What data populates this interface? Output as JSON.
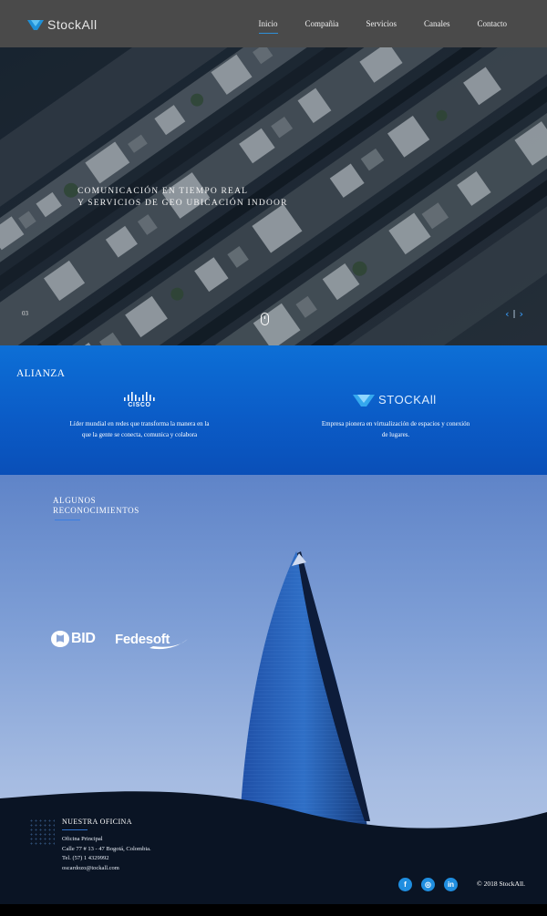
{
  "header": {
    "brand": "StockAll",
    "nav": [
      "Inicio",
      "Compañia",
      "Servicios",
      "Canales",
      "Contacto"
    ],
    "active_nav": "Inicio"
  },
  "hero": {
    "caption_line1": "Comunicación en tiempo real",
    "caption_line2": "y servicios de geo ubicación indoor",
    "slide_number": "03",
    "prev_arrow": "‹",
    "separator": "|",
    "next_arrow": "›"
  },
  "alianza": {
    "title": "ALIANZA",
    "cisco": {
      "logo_text": "CISCO",
      "description_line1": "Líder mundial en redes que transforma la manera en la",
      "description_line2": "que la gente se conecta, comunica y colabora"
    },
    "stockall": {
      "logo_text": "STOCKAll",
      "description_line1": "Empresa pionera en virtualización de espacios y conexión",
      "description_line2": "de lugares."
    }
  },
  "reconocimientos": {
    "title_line1": "ALGUNOS",
    "title_line2": "RECONOCIMIENTOS",
    "logos": [
      "BID",
      "Fedesoft"
    ]
  },
  "footer": {
    "office_title": "NUESTRA OFICINA",
    "office_lines": [
      "Oficina Principal",
      "Calle 77 # 13 - 47 Bogotá, Colombia.",
      "Tel. (57) 1 4329992",
      "oscardozo@tockall.com"
    ],
    "social": [
      "facebook-icon",
      "instagram-icon",
      "linkedin-icon"
    ],
    "social_labels": [
      "f",
      "◎",
      "in"
    ],
    "copyright": "© 2018 StockAll."
  },
  "colors": {
    "header_bg": "#4a4a4a",
    "accent_blue": "#1f8ee0",
    "alianza_bg": "#0b5cc7",
    "footer_bg": "#0a1424"
  }
}
